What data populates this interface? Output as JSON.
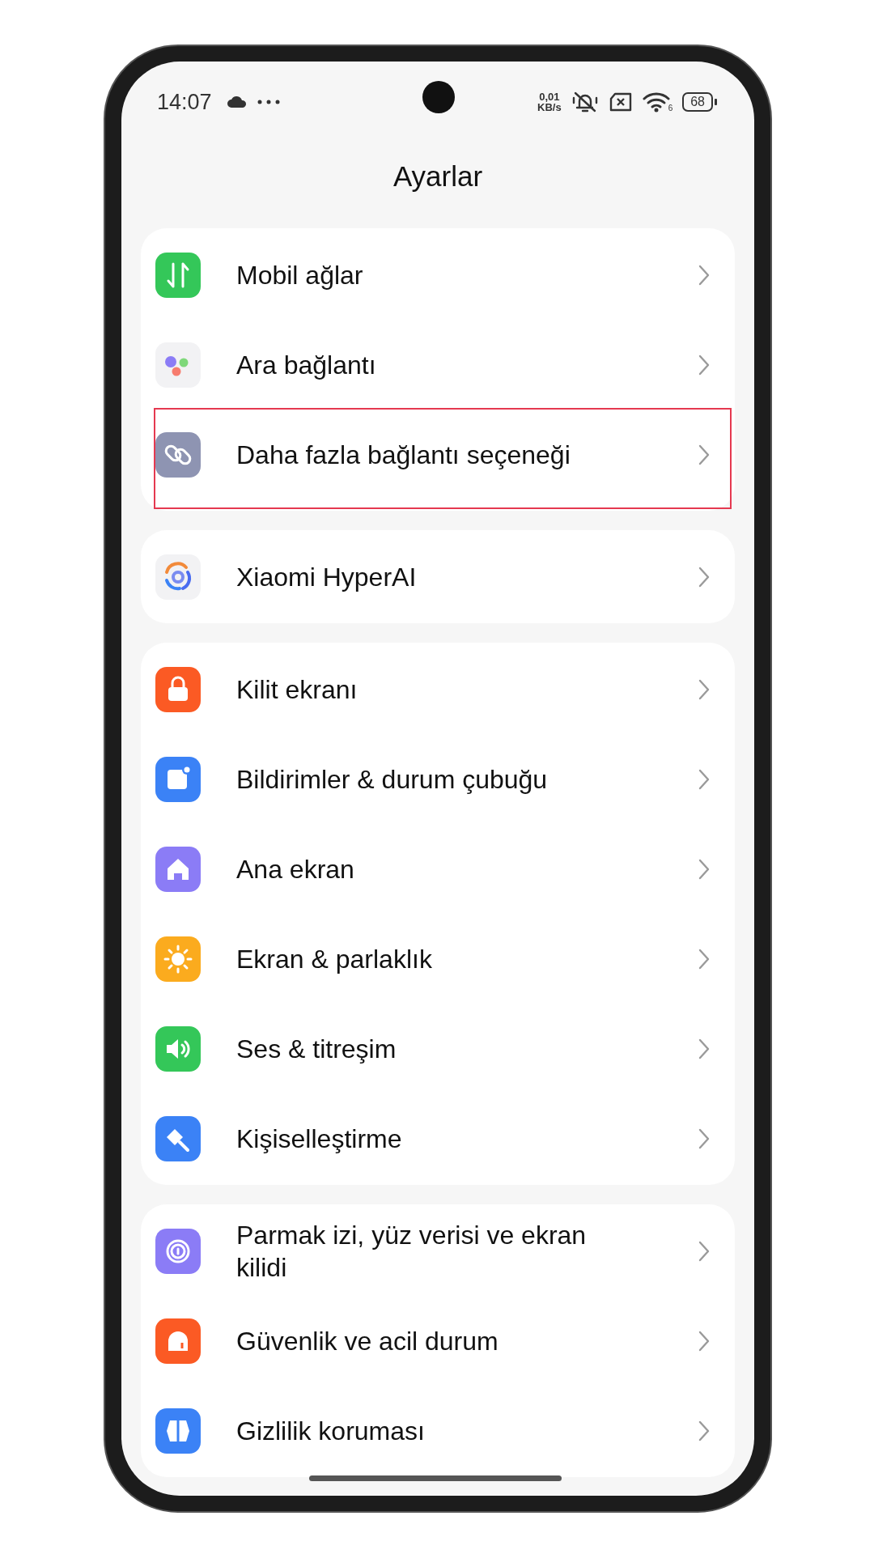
{
  "status_bar": {
    "time": "14:07",
    "speed_value": "0,01",
    "speed_unit": "KB/s",
    "wifi_band": "6",
    "battery": "68"
  },
  "title": "Ayarlar",
  "groups": [
    {
      "items": [
        {
          "label": "Mobil ağlar",
          "color": "#34c759",
          "highlighted": false
        },
        {
          "label": "Ara bağlantı",
          "color": "#f2f2f4",
          "highlighted": false
        },
        {
          "label": "Daha fazla bağlantı seçeneği",
          "color": "#8e94b2",
          "highlighted": true
        }
      ]
    },
    {
      "items": [
        {
          "label": "Xiaomi HyperAI",
          "color": "#f2f2f4",
          "highlighted": false
        }
      ]
    },
    {
      "items": [
        {
          "label": "Kilit ekranı",
          "color": "#fb5a24",
          "highlighted": false
        },
        {
          "label": "Bildirimler & durum çubuğu",
          "color": "#3b82f6",
          "highlighted": false
        },
        {
          "label": "Ana ekran",
          "color": "#8b7cf6",
          "highlighted": false
        },
        {
          "label": "Ekran & parlaklık",
          "color": "#fbab1e",
          "highlighted": false
        },
        {
          "label": "Ses & titreşim",
          "color": "#34c759",
          "highlighted": false
        },
        {
          "label": "Kişiselleştirme",
          "color": "#3b82f6",
          "highlighted": false
        }
      ]
    },
    {
      "items": [
        {
          "label": "Parmak izi, yüz verisi ve ekran kilidi",
          "color": "#8b7cf6",
          "highlighted": false
        },
        {
          "label": "Güvenlik ve acil durum",
          "color": "#fb5a24",
          "highlighted": false
        },
        {
          "label": "Gizlilik koruması",
          "color": "#3b82f6",
          "highlighted": false
        }
      ]
    }
  ]
}
